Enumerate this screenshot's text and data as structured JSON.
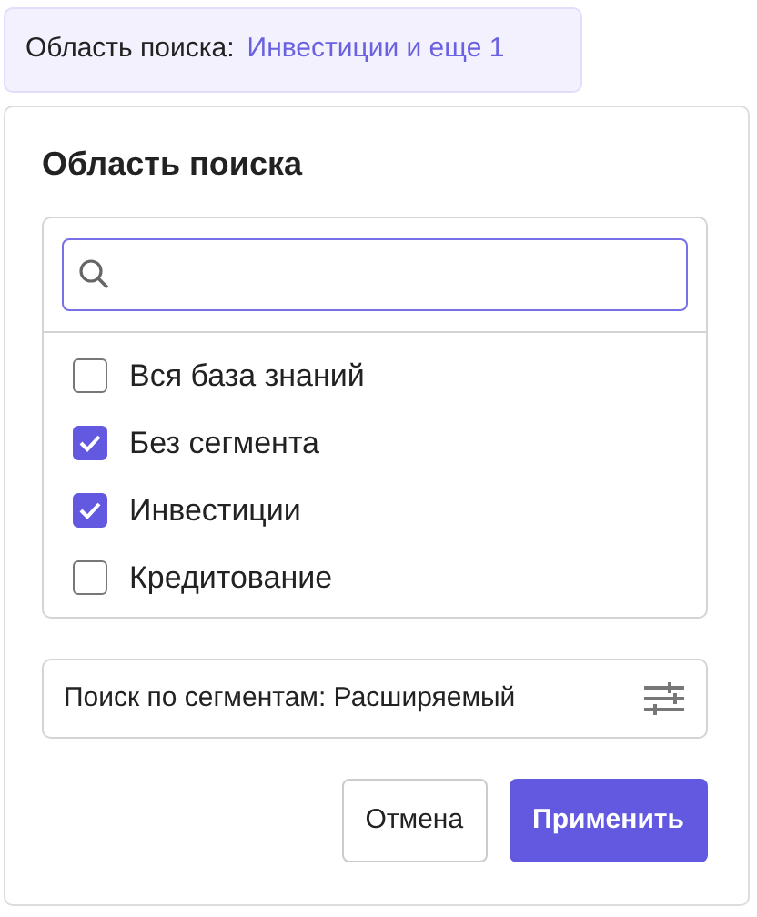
{
  "scope_chip": {
    "label": "Область поиска:",
    "value": "Инвестиции и еще 1"
  },
  "panel": {
    "title": "Область поиска",
    "options": [
      {
        "label": "Вся база знаний",
        "checked": false
      },
      {
        "label": "Без сегмента",
        "checked": true
      },
      {
        "label": "Инвестиции",
        "checked": true
      },
      {
        "label": "Кредитование",
        "checked": false
      }
    ],
    "mode": "Поиск по сегментам: Расширяемый",
    "buttons": [
      {
        "label": "Отмена",
        "kind": "secondary"
      },
      {
        "label": "Применить",
        "kind": "primary"
      }
    ]
  }
}
